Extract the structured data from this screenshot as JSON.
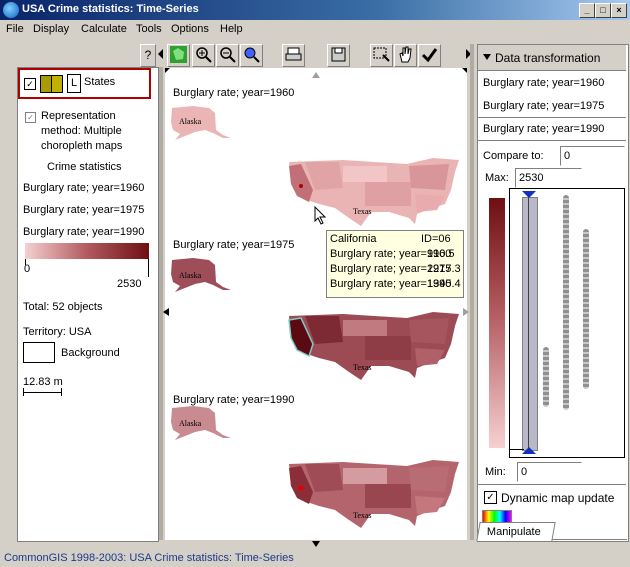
{
  "window": {
    "title": "USA Crime statistics: Time-Series"
  },
  "menu": [
    "File",
    "Display",
    "Calculate",
    "Tools",
    "Options",
    "Help"
  ],
  "toolbar": {
    "help_label": "?"
  },
  "legend": {
    "layer_name": "States",
    "layer_key": "L",
    "representation": [
      "Representation",
      "method: Multiple",
      "choropleth maps"
    ],
    "crime_title": "Crime statistics",
    "attributes": [
      "Burglary rate; year=1960",
      "Burglary rate; year=1975",
      "Burglary rate; year=1990"
    ],
    "scale_min": "0",
    "scale_max": "2530",
    "total": "Total: 52 objects",
    "territory": "Territory: USA",
    "background": "Background",
    "scale_text": "12.83 m"
  },
  "maps": [
    {
      "title": "Burglary rate; year=1960",
      "alaska": "Alaska",
      "texas": "Texas"
    },
    {
      "title": "Burglary rate; year=1975",
      "alaska": "Alaska",
      "texas": "Texas"
    },
    {
      "title": "Burglary rate; year=1990",
      "alaska": "Alaska",
      "texas": "Texas"
    }
  ],
  "tooltip": {
    "name": "California",
    "id": "ID=06",
    "rows": [
      {
        "label": "Burglary rate; year=1960",
        "value": "910.5"
      },
      {
        "label": "Burglary rate; year=1975",
        "value": "2217.3"
      },
      {
        "label": "Burglary rate; year=1990",
        "value": "1345.4"
      }
    ]
  },
  "right_panel": {
    "header": "Data transformation",
    "attributes": [
      "Burglary rate; year=1960",
      "Burglary rate; year=1975",
      "Burglary rate; year=1990"
    ],
    "compare_label": "Compare to:",
    "compare_value": "0",
    "max_label": "Max:",
    "max_value": "2530",
    "min_label": "Min:",
    "min_value": "0",
    "dynamic_update": "Dynamic map update",
    "tab": "Manipulate"
  },
  "status": "CommonGIS 1998-2003: USA Crime statistics: Time-Series",
  "colors": {
    "light": "#f2c9c9",
    "dark": "#6e0f12",
    "highlight": "#b00000"
  }
}
